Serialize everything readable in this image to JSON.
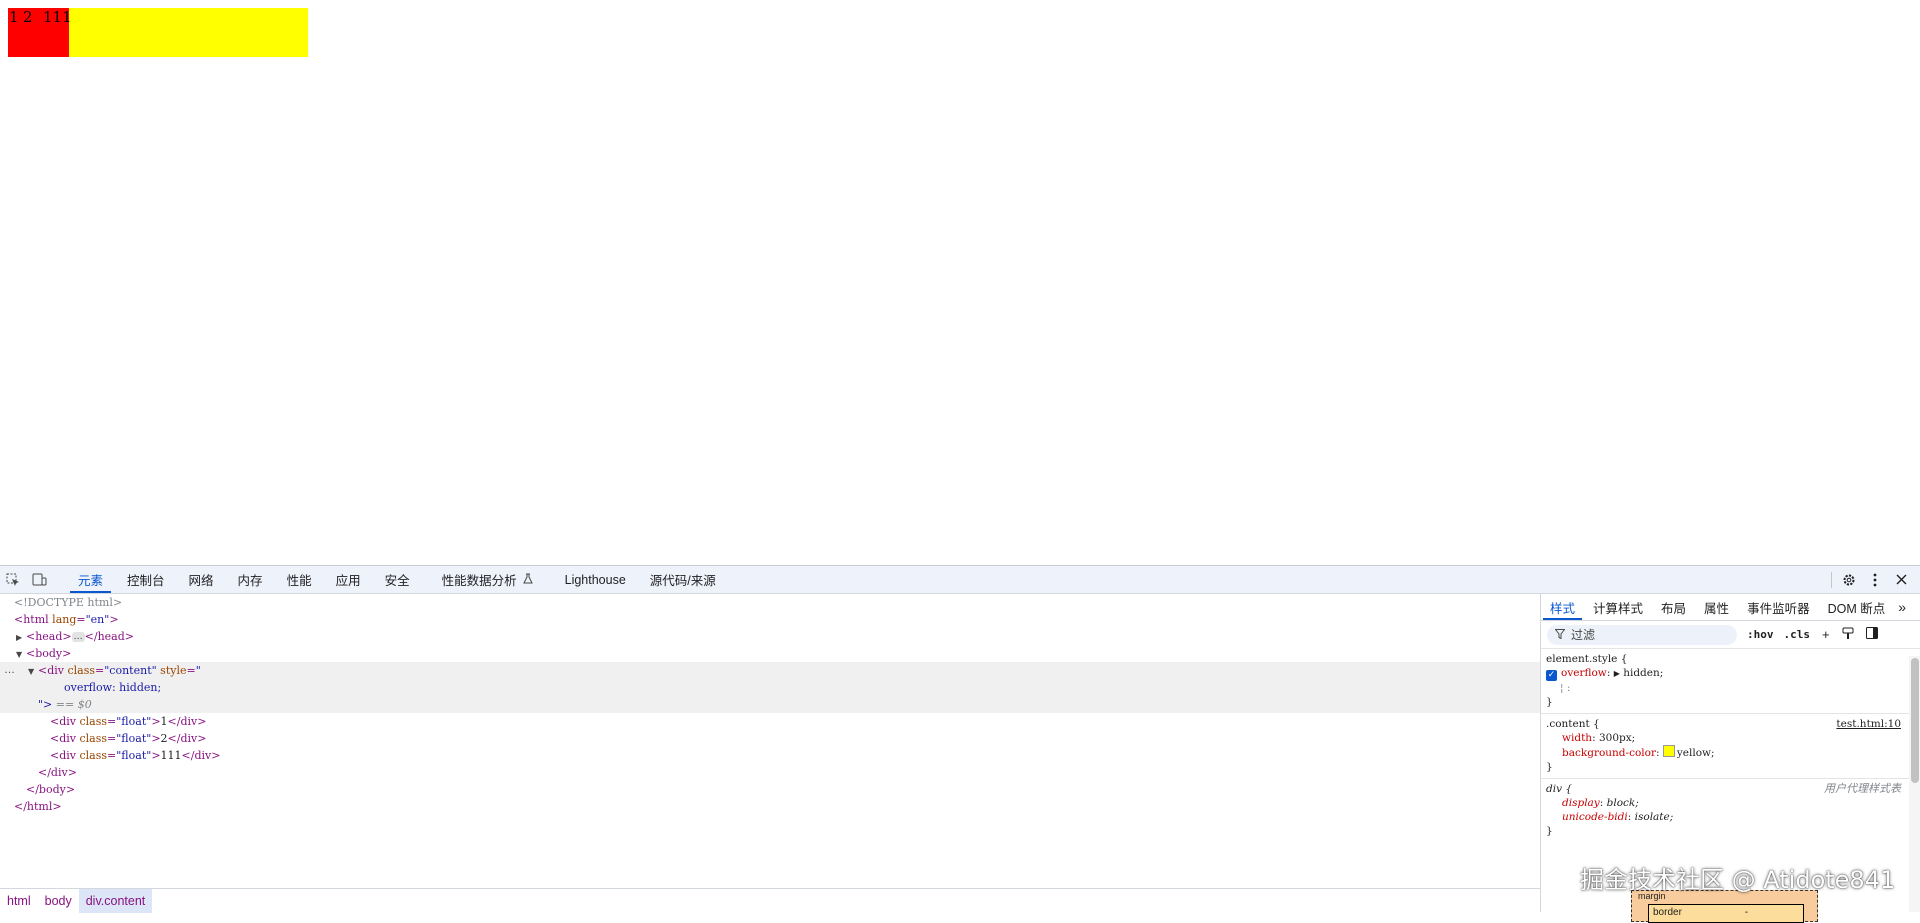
{
  "page": {
    "content_boxes": [
      "1",
      "2",
      "111"
    ],
    "content_background": "#ffff00",
    "float_background": "#ff0000"
  },
  "devtools": {
    "toolbar": {
      "tabs": [
        "元素",
        "控制台",
        "网络",
        "内存",
        "性能",
        "应用",
        "安全",
        "性能数据分析",
        "Lighthouse",
        "源代码/来源"
      ],
      "active_tab": "元素"
    },
    "dom": {
      "doctype": "<!DOCTYPE html>",
      "html_open_tag": "<html",
      "html_lang_attr": "lang",
      "html_lang_val": "\"en\"",
      "head_open": "<head>",
      "head_close": "</head>",
      "ellipsis": "…",
      "body_open": "<body>",
      "div_open": "<div",
      "class_attr": "class",
      "content_class_val": "\"content\"",
      "style_attr": "style",
      "style_val_open": "\"",
      "style_text": "overflow: hidden;",
      "style_val_close": "\">",
      "eq0": "== $0",
      "float_class_val": "\"float\"",
      "child_texts": [
        "1",
        "2",
        "111"
      ],
      "div_close": "</div>",
      "body_close": "</body>",
      "html_close": "</html>",
      "gutter_dots": "…"
    },
    "breadcrumb": [
      "html",
      "body",
      "div.content"
    ],
    "sidebar": {
      "tabs": [
        "样式",
        "计算样式",
        "布局",
        "属性",
        "事件监听器",
        "DOM 断点"
      ],
      "active_tab": "样式",
      "filter_placeholder": "过滤",
      "hov": ":hov",
      "cls": ".cls",
      "element_style_selector": "element.style {",
      "element_style_prop": "overflow",
      "element_style_val": "hidden;",
      "rule1_selector": ".content {",
      "rule1_source": "test.html:10",
      "rule1_props": [
        {
          "name": "width",
          "value": "300px;"
        },
        {
          "name": "background-color",
          "value": "yellow;"
        }
      ],
      "rule2_selector": "div {",
      "rule2_source": "用户代理样式表",
      "rule2_props": [
        {
          "name": "display",
          "value": "block;"
        },
        {
          "name": "unicode-bidi",
          "value": "isolate;"
        }
      ],
      "close_brace": "}",
      "box_margin_label": "margin",
      "box_border_label": "border",
      "box_border_value": "-"
    }
  },
  "watermark": "掘金技术社区 @ Atidote841"
}
